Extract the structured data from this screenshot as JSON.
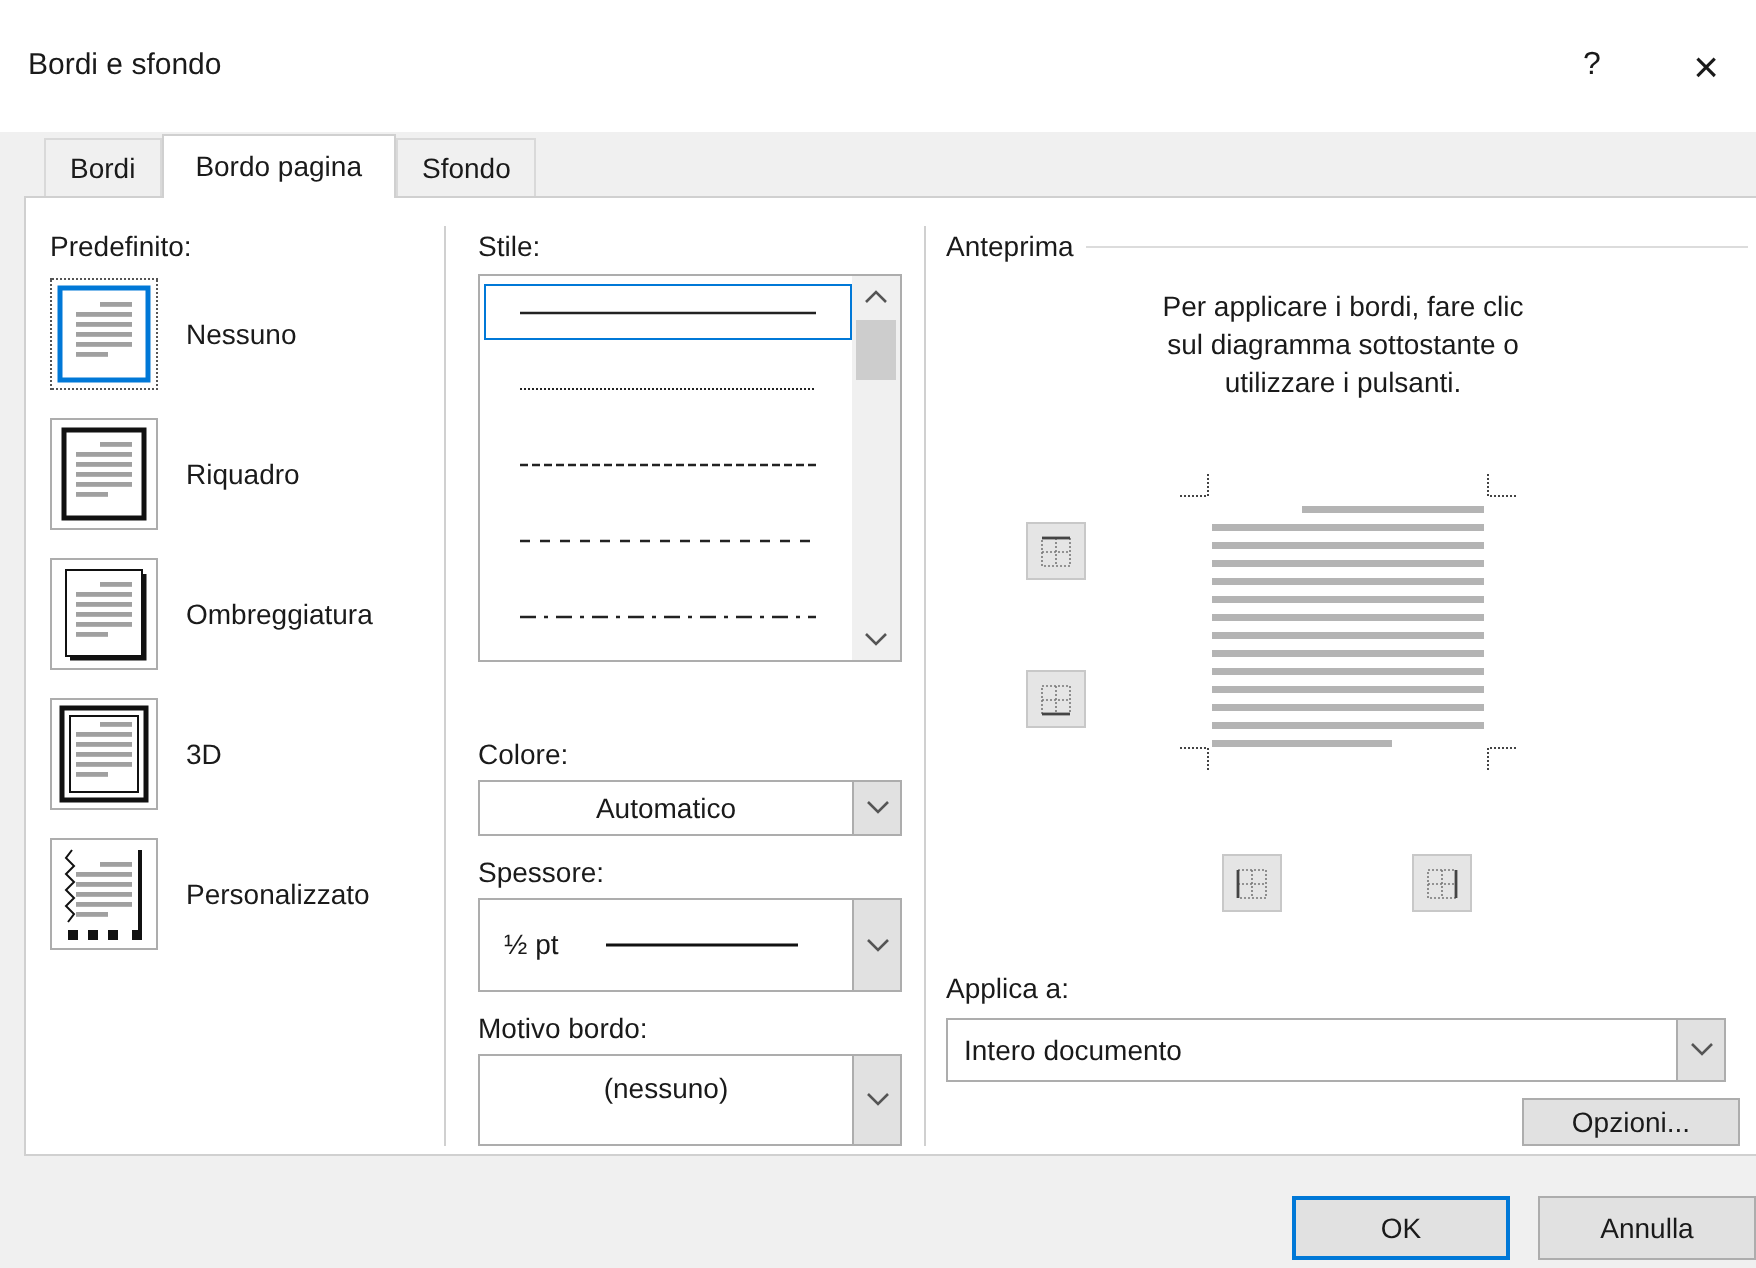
{
  "window": {
    "title": "Bordi e sfondo",
    "help_button": "?",
    "close_button": "×"
  },
  "tabs": [
    {
      "label": "Bordi",
      "selected": false
    },
    {
      "label": "Bordo pagina",
      "selected": true
    },
    {
      "label": "Sfondo",
      "selected": false
    }
  ],
  "preset": {
    "label": "Predefinito:",
    "items": [
      {
        "label": "Nessuno",
        "kind": "none",
        "selected": true
      },
      {
        "label": "Riquadro",
        "kind": "box",
        "selected": false
      },
      {
        "label": "Ombreggiatura",
        "kind": "shadow",
        "selected": false
      },
      {
        "label": "3D",
        "kind": "threed",
        "selected": false
      },
      {
        "label": "Personalizzato",
        "kind": "custom",
        "selected": false
      }
    ]
  },
  "style": {
    "label": "Stile:",
    "items": [
      {
        "kind": "solid",
        "selected": true
      },
      {
        "kind": "dotted",
        "selected": false
      },
      {
        "kind": "dashed",
        "selected": false
      },
      {
        "kind": "spaced",
        "selected": false
      },
      {
        "kind": "dashdot",
        "selected": false
      }
    ]
  },
  "color": {
    "label": "Colore:",
    "value": "Automatico"
  },
  "width": {
    "label": "Spessore:",
    "value": "½ pt"
  },
  "art": {
    "label": "Motivo bordo:",
    "value": "(nessuno)"
  },
  "preview": {
    "label": "Anteprima",
    "hint": "Per applicare i bordi, fare clic sul diagramma sottostante o utilizzare i pulsanti.",
    "buttons": [
      {
        "kind": "top"
      },
      {
        "kind": "bottom"
      },
      {
        "kind": "left"
      },
      {
        "kind": "right"
      }
    ]
  },
  "apply_to": {
    "label": "Applica a:",
    "value": "Intero documento"
  },
  "options_button": "Opzioni...",
  "footer_buttons": [
    {
      "label": "OK",
      "default": true
    },
    {
      "label": "Annulla",
      "default": false
    }
  ]
}
